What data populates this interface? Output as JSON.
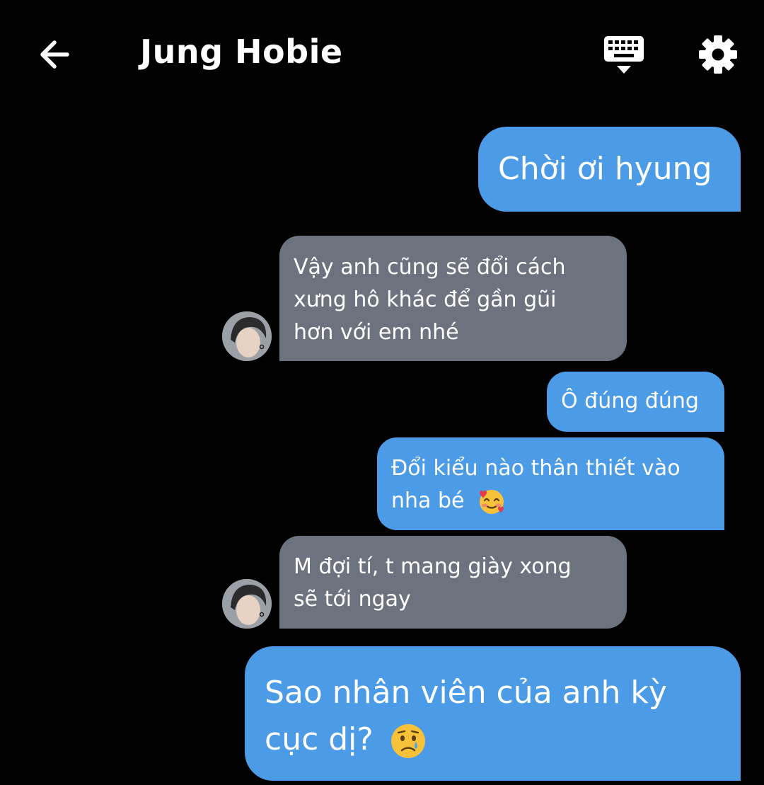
{
  "header": {
    "title": "Jung Hobie",
    "back_icon": "arrow-left-icon",
    "keyboard_icon": "keyboard-hide-icon",
    "settings_icon": "gear-icon"
  },
  "colors": {
    "background": "#000000",
    "sent_bubble": "#4b9be6",
    "received_bubble": "#6c737f"
  },
  "messages": [
    {
      "from": "me",
      "text": "Chời ơi hyung"
    },
    {
      "from": "contact",
      "text": "Vậy anh cũng sẽ đổi cách\nxưng hô khác để gần gũi\nhơn với em nhé"
    },
    {
      "from": "me",
      "text": "Ô đúng đúng"
    },
    {
      "from": "me",
      "text": "Đổi kiểu nào thân thiết vào\nnha bé",
      "emoji": "smiling-face-with-hearts-icon"
    },
    {
      "from": "contact",
      "text": "M đợi tí, t mang giày xong\nsẽ tới ngay"
    },
    {
      "from": "me",
      "text": "Sao nhân viên của anh kỳ\ncục dị?",
      "emoji": "crying-face-icon"
    }
  ]
}
